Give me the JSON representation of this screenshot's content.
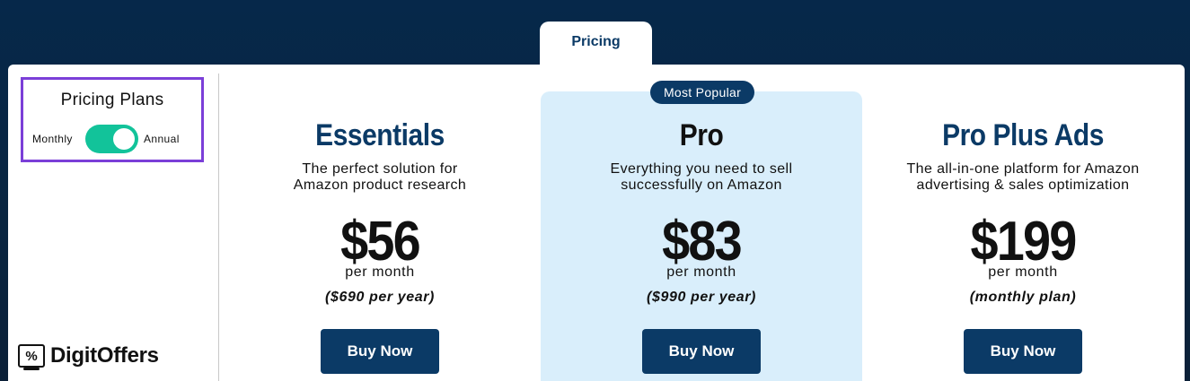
{
  "tab": {
    "label": "Pricing"
  },
  "sidebar": {
    "title": "Pricing Plans",
    "toggle": {
      "left_label": "Monthly",
      "right_label": "Annual",
      "state": "annual"
    },
    "logo": {
      "icon_glyph": "%",
      "text": "DigitOffers"
    }
  },
  "badge": "Most Popular",
  "colors": {
    "navy": "#0b3a66",
    "toggle_green": "#12c39a",
    "highlight_bg": "#d9eefb",
    "focus_border": "#7b3fd8"
  },
  "plans": [
    {
      "name": "Essentials",
      "desc_line1": "The perfect solution for",
      "desc_line2": "Amazon product research",
      "price": "$56",
      "per": "per month",
      "note": "($690 per year)",
      "button": "Buy Now"
    },
    {
      "name": "Pro",
      "desc_line1": "Everything you need to sell",
      "desc_line2": "successfully on Amazon",
      "price": "$83",
      "per": "per month",
      "note": "($990 per year)",
      "button": "Buy Now"
    },
    {
      "name": "Pro Plus Ads",
      "desc_line1": "The all-in-one platform for Amazon",
      "desc_line2": "advertising & sales optimization",
      "price": "$199",
      "per": "per month",
      "note": "(monthly plan)",
      "button": "Buy Now"
    }
  ]
}
